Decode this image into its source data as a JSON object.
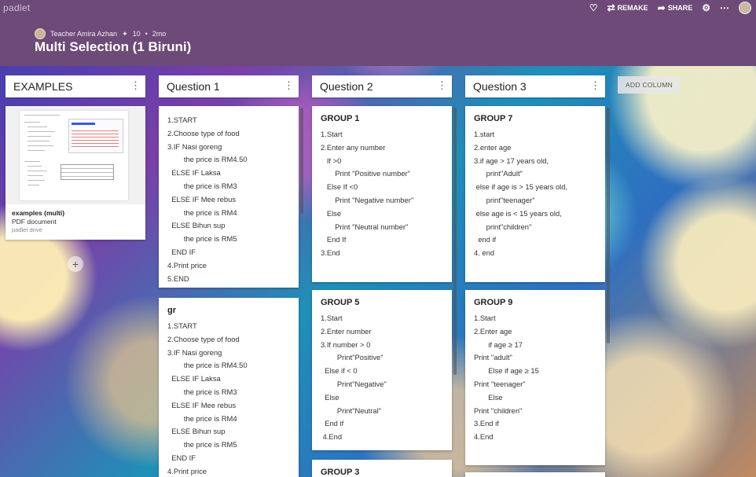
{
  "app": {
    "brand": "padlet"
  },
  "header": {
    "author": "Teacher Amira Azhan",
    "likes": "10",
    "age": "2mo",
    "title": "Multi Selection (1 Biruni)",
    "remake_label": "REMAKE",
    "share_label": "SHARE"
  },
  "columns": {
    "examples": {
      "title": "EXAMPLES",
      "pdf": {
        "name": "examples (multi)",
        "type": "PDF document",
        "source": "padlet drive"
      },
      "add_icon": "+"
    },
    "q1": {
      "title": "Question 1",
      "card1": {
        "lines": [
          "1.START",
          "2.Choose type of food",
          "3.IF Nasi goreng",
          "        the price is RM4.50",
          "  ELSE IF Laksa",
          "        the price is RM3",
          "  ELSE IF Mee rebus",
          "        the price is RM4",
          "  ELSE Bihun sup",
          "        the price is RM5",
          "  END IF",
          "4.Print price",
          "5.END"
        ]
      },
      "card2": {
        "title": "gr",
        "lines": [
          "1.START",
          "2.Choose type of food",
          "3.IF Nasi goreng",
          "        the price is RM4.50",
          "  ELSE IF Laksa",
          "        the price is RM3",
          "  ELSE IF Mee rebus",
          "        the price is RM4",
          "  ELSE Bihun sup",
          "        the price is RM5",
          "  END IF",
          "4.Print price"
        ]
      }
    },
    "q2": {
      "title": "Question 2",
      "card1": {
        "title": "GROUP 1",
        "lines": [
          "1.Start",
          "2.Enter any number",
          "   If >0",
          "       Print \"Positive number\"",
          "   Else If <0",
          "       Print \"Negative number\"",
          "   Else",
          "       Print \"Neutral number\"",
          "   End If",
          "3.End"
        ]
      },
      "card2": {
        "title": "GROUP 5",
        "lines": [
          "1.Start",
          "2.Enter number",
          "3.If number > 0",
          "        Print\"Positive\"",
          "  Else if < 0",
          "        Print\"Negative\"",
          "  Else",
          "        Print\"Neutral\"",
          "  End if",
          " 4.End"
        ]
      },
      "card3": {
        "title": "GROUP 3"
      }
    },
    "q3": {
      "title": "Question 3",
      "card1": {
        "title": "GROUP 7",
        "lines": [
          "1.start",
          "2.enter age",
          "3.if age > 17 years old,",
          "      print\"Adult\"",
          " else if age is > 15 years old,",
          "      print\"teenager\"",
          " else age is < 15 years old,",
          "      print\"children\"",
          "  end if",
          "4. end"
        ]
      },
      "card2": {
        "title": "GROUP 9",
        "lines": [
          "1.Start",
          "2.Enter age",
          "       if age ≥ 17",
          "Print \"adult\"",
          "       Else if age ≥ 15",
          "Print \"teenager\"",
          "       Else",
          "Print \"children\"",
          "3.End if",
          "4.End"
        ]
      }
    }
  },
  "add_column_label": "ADD COLUMN",
  "icons": {
    "heart": "heart-icon",
    "remake": "remake-icon",
    "share": "share-icon",
    "settings": "gear-icon",
    "more": "more-icon"
  }
}
